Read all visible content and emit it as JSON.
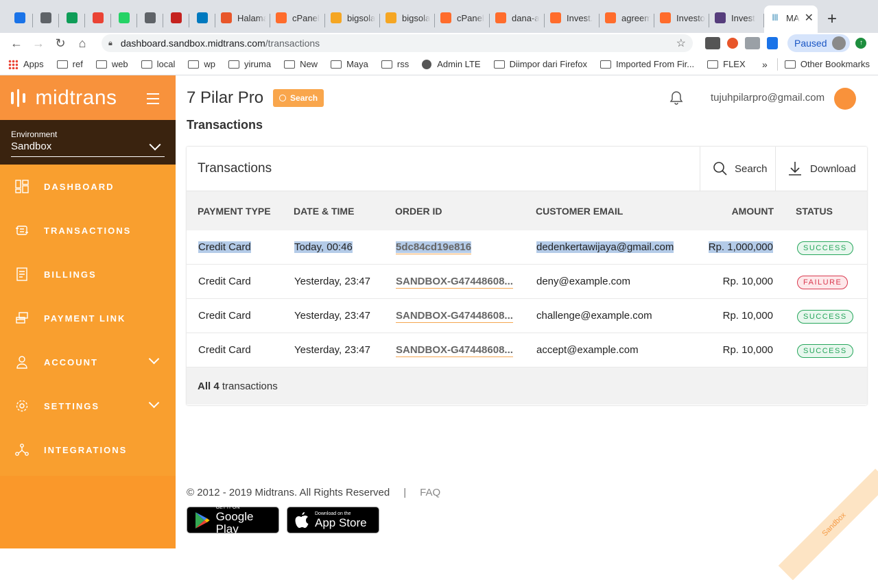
{
  "browser": {
    "tabs": [
      {
        "title": "",
        "color": "#1a73e8"
      },
      {
        "title": "",
        "color": "#5f6368"
      },
      {
        "title": "",
        "color": "#0f9d58"
      },
      {
        "title": "",
        "color": "#ea4335"
      },
      {
        "title": "",
        "color": "#25d366"
      },
      {
        "title": "",
        "color": "#5f6368"
      },
      {
        "title": "",
        "color": "#c5221f"
      },
      {
        "title": "",
        "color": "#0079bf"
      },
      {
        "title": "Halama",
        "color": "#e8562a"
      },
      {
        "title": "cPanel",
        "color": "#ff6c2c"
      },
      {
        "title": "bigsola",
        "color": "#f5a623"
      },
      {
        "title": "bigsola",
        "color": "#f5a623"
      },
      {
        "title": "cPanel",
        "color": "#ff6c2c"
      },
      {
        "title": "dana-a",
        "color": "#ff6c2c"
      },
      {
        "title": "Invest.",
        "color": "#ff6c2c"
      },
      {
        "title": "agreem",
        "color": "#ff6c2c"
      },
      {
        "title": "Investo",
        "color": "#ff6c2c"
      },
      {
        "title": "Invest",
        "color": "#563d7c"
      }
    ],
    "active_tab": {
      "title": "MA",
      "close": "✕"
    },
    "new_tab": "+",
    "url_host": "dashboard.sandbox.midtrans.com",
    "url_path": "/transactions",
    "profile_status": "Paused",
    "bookmarks": [
      "Apps",
      "ref",
      "web",
      "local",
      "wp",
      "yiruma",
      "New",
      "Maya",
      "rss",
      "Admin LTE",
      "Diimpor dari Firefox",
      "Imported From Fir...",
      "FLEX"
    ],
    "bookmarks_overflow": "»",
    "other_bookmarks": "Other Bookmarks"
  },
  "sidebar": {
    "brand": "midtrans",
    "environment_label": "Environment",
    "environment_value": "Sandbox",
    "items": [
      {
        "label": "DASHBOARD",
        "icon": "dashboard-icon"
      },
      {
        "label": "TRANSACTIONS",
        "icon": "transactions-icon"
      },
      {
        "label": "BILLINGS",
        "icon": "billings-icon"
      },
      {
        "label": "PAYMENT LINK",
        "icon": "payment-link-icon"
      },
      {
        "label": "ACCOUNT",
        "icon": "account-icon"
      },
      {
        "label": "SETTINGS",
        "icon": "gear-icon"
      },
      {
        "label": "INTEGRATIONS",
        "icon": "integrations-icon"
      }
    ]
  },
  "header": {
    "merchant": "7 Pilar Pro",
    "search_btn": "Search",
    "user_email": "tujuhpilarpro@gmail.com"
  },
  "page_title": "Transactions",
  "card": {
    "title": "Transactions",
    "search": "Search",
    "download": "Download",
    "columns": [
      "PAYMENT TYPE",
      "DATE & TIME",
      "ORDER ID",
      "CUSTOMER EMAIL",
      "AMOUNT",
      "STATUS"
    ],
    "rows": [
      {
        "type": "Credit Card",
        "date": "Today, 00:46",
        "order_id": "5dc84cd19e816",
        "email": "dedenkertawijaya@gmail.com",
        "amount": "Rp. 1,000,000",
        "status": "SUCCESS"
      },
      {
        "type": "Credit Card",
        "date": "Yesterday, 23:47",
        "order_id": "SANDBOX-G47448608...",
        "email": "deny@example.com",
        "amount": "Rp. 10,000",
        "status": "FAILURE"
      },
      {
        "type": "Credit Card",
        "date": "Yesterday, 23:47",
        "order_id": "SANDBOX-G47448608...",
        "email": "challenge@example.com",
        "amount": "Rp. 10,000",
        "status": "SUCCESS"
      },
      {
        "type": "Credit Card",
        "date": "Yesterday, 23:47",
        "order_id": "SANDBOX-G47448608...",
        "email": "accept@example.com",
        "amount": "Rp. 10,000",
        "status": "SUCCESS"
      }
    ],
    "footer_prefix": "All",
    "footer_count": "4",
    "footer_suffix": "transactions"
  },
  "footer": {
    "copyright": "© 2012 - 2019 Midtrans. All Rights Reserved",
    "separator": "|",
    "faq": "FAQ",
    "google_small": "GET IT ON",
    "google_big": "Google Play",
    "apple_small": "Download on the",
    "apple_big": "App Store"
  },
  "ribbon": "Sandbox"
}
